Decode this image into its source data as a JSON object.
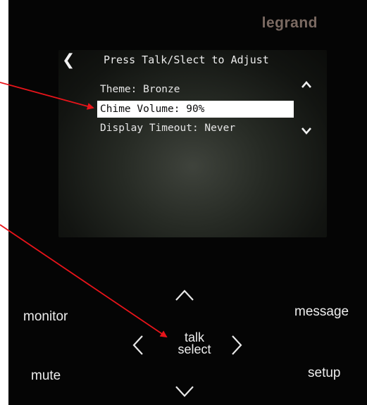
{
  "brand": "legrand",
  "screen": {
    "back_icon": "chevron-left-icon",
    "title": "Press Talk/Slect to Adjust",
    "scroll_up_icon": "chevron-up-icon",
    "scroll_down_icon": "chevron-down-icon",
    "menu_items": [
      {
        "label": "Theme: Bronze",
        "selected": false
      },
      {
        "label": "Chime Volume: 90%",
        "selected": true
      },
      {
        "label": "Display Timeout: Never",
        "selected": false
      }
    ]
  },
  "keypad": {
    "monitor": "monitor",
    "message": "message",
    "mute": "mute",
    "setup": "setup",
    "talk_line1": "talk",
    "talk_line2": "select",
    "up_icon": "chevron-up-icon",
    "down_icon": "chevron-down-icon",
    "left_icon": "chevron-left-icon",
    "right_icon": "chevron-right-icon"
  },
  "annotations": {
    "color": "#e8141a",
    "arrows": [
      {
        "points_to": "Chime Volume: 90%"
      },
      {
        "points_to": "talk select"
      }
    ]
  }
}
